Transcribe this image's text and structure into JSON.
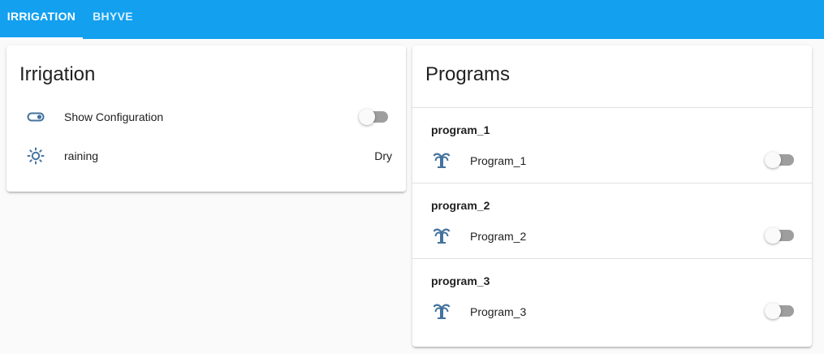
{
  "tabs": [
    {
      "label": "IRRIGATION",
      "active": true
    },
    {
      "label": "BHYVE",
      "active": false
    }
  ],
  "colors": {
    "header": "#12a0ef",
    "icon": "#44739e",
    "toggle_off_track": "#9e9e9e"
  },
  "irrigation_card": {
    "title": "Irrigation",
    "rows": [
      {
        "icon": "toggle-switch-outline-icon",
        "label": "Show Configuration",
        "type": "toggle",
        "on": false
      },
      {
        "icon": "weather-sunny-icon",
        "label": "raining",
        "value": "Dry"
      }
    ]
  },
  "programs_card": {
    "title": "Programs",
    "programs": [
      {
        "name": "program_1",
        "entity_label": "Program_1",
        "icon": "sprinkler-icon",
        "on": false
      },
      {
        "name": "program_2",
        "entity_label": "Program_2",
        "icon": "sprinkler-icon",
        "on": false
      },
      {
        "name": "program_3",
        "entity_label": "Program_3",
        "icon": "sprinkler-icon",
        "on": false
      }
    ]
  }
}
